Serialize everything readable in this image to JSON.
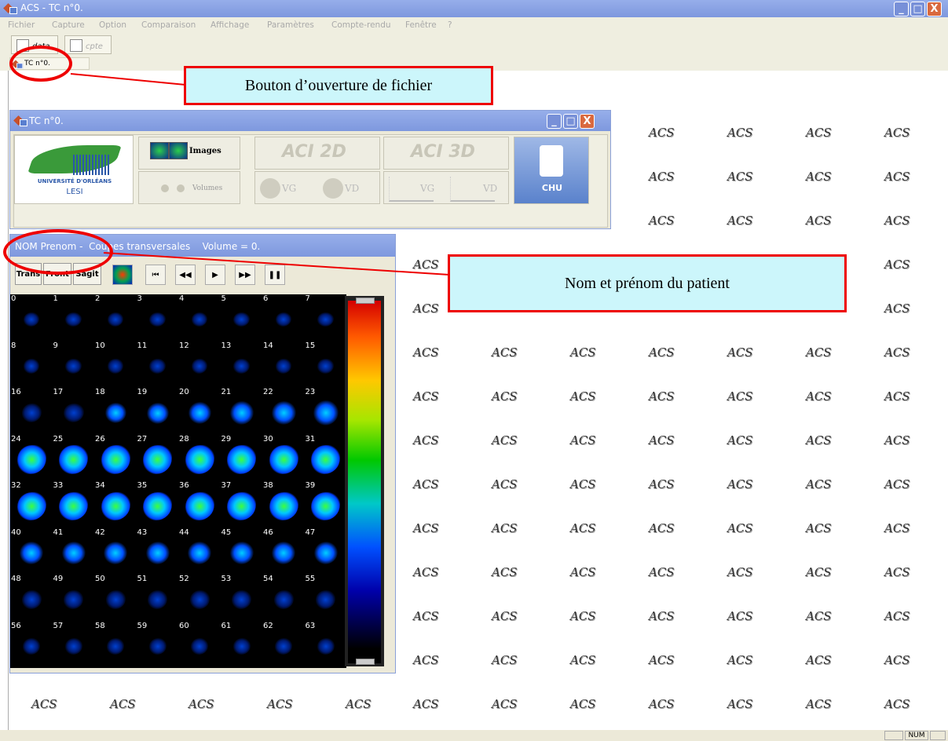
{
  "window": {
    "title": "ACS - TC n°0.",
    "min": "_",
    "max": "□",
    "close": "X"
  },
  "menu": [
    "Fichier",
    "Capture",
    "Option",
    "Comparaison",
    "Affichage",
    "Paramètres",
    "Compte-rendu",
    "Fenêtre",
    "?"
  ],
  "toolbar": {
    "open_label": "data",
    "report_label": "cpte"
  },
  "tab": {
    "label": "TC n°0."
  },
  "tc_window": {
    "title": "TC n°0.",
    "university": "UNIVERSITÉ D'ORLÉANS",
    "lab": "LESI",
    "images_label": "Images",
    "volumes_label": "Volumes",
    "aci2d": "ACI 2D",
    "aci3d": "ACI 3D",
    "vg": "VG",
    "vd": "VD",
    "chu": "CHU"
  },
  "nom_window": {
    "title": "NOM Prenom -  Coupes transversales    Volume = 0.",
    "view_buttons": [
      "Trans",
      "Front",
      "Sagit"
    ],
    "playback": [
      "⏮",
      "◀◀",
      "▶",
      "▶▶",
      "❚❚"
    ],
    "slices": [
      0,
      1,
      2,
      3,
      4,
      5,
      6,
      7,
      8,
      9,
      10,
      11,
      12,
      13,
      14,
      15,
      16,
      17,
      18,
      19,
      20,
      21,
      22,
      23,
      24,
      25,
      26,
      27,
      28,
      29,
      30,
      31,
      32,
      33,
      34,
      35,
      36,
      37,
      38,
      39,
      40,
      41,
      42,
      43,
      44,
      45,
      46,
      47,
      48,
      49,
      50,
      51,
      52,
      53,
      54,
      55,
      56,
      57,
      58,
      59,
      60,
      61,
      62,
      63
    ]
  },
  "background_label": "ACS",
  "annotations": {
    "file_button": "Bouton d’ouverture de fichier",
    "patient_name": "Nom et prénom du patient"
  },
  "status": {
    "num": "NUM"
  }
}
